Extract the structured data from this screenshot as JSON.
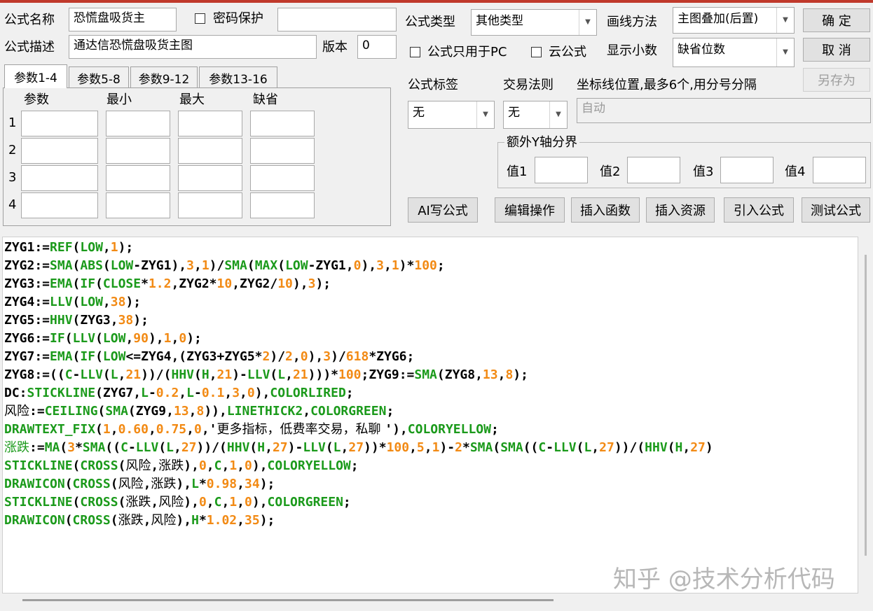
{
  "header": {
    "name_label": "公式名称",
    "name_value": "恐慌盘吸货主",
    "password_label": "密码保护",
    "password_value": "",
    "desc_label": "公式描述",
    "desc_value": "通达信恐慌盘吸货主图",
    "version_label": "版本",
    "version_value": "0"
  },
  "right": {
    "type_label": "公式类型",
    "type_value": "其他类型",
    "draw_label": "画线方法",
    "draw_value": "主图叠加(后置)",
    "pc_only_label": "公式只用于PC",
    "cloud_label": "云公式",
    "decimal_label": "显示小数",
    "decimal_value": "缺省位数",
    "tag_label": "公式标签",
    "tag_value": "无",
    "rule_label": "交易法则",
    "rule_value": "无",
    "axis_label": "坐标线位置,最多6个,用分号分隔",
    "axis_value": "自动",
    "yaxis_group_label": "额外Y轴分界",
    "yaxis": [
      "值1",
      "值2",
      "值3",
      "值4"
    ]
  },
  "buttons": {
    "ok": "确  定",
    "cancel": "取  消",
    "save_as": "另存为",
    "ai": "AI写公式",
    "edit": "编辑操作",
    "insert_func": "插入函数",
    "insert_res": "插入资源",
    "import": "引入公式",
    "test": "测试公式"
  },
  "params": {
    "tabs": [
      "参数1-4",
      "参数5-8",
      "参数9-12",
      "参数13-16"
    ],
    "columns": [
      "参数",
      "最小",
      "最大",
      "缺省"
    ],
    "rows": [
      "1",
      "2",
      "3",
      "4"
    ]
  },
  "code": {
    "lines": [
      [
        [
          "t",
          "ZYG1:="
        ],
        [
          "k",
          "REF"
        ],
        [
          "t",
          "("
        ],
        [
          "k",
          "LOW"
        ],
        [
          "t",
          ","
        ],
        [
          "n",
          "1"
        ],
        [
          "t",
          ");"
        ]
      ],
      [
        [
          "t",
          "ZYG2:="
        ],
        [
          "k",
          "SMA"
        ],
        [
          "t",
          "("
        ],
        [
          "k",
          "ABS"
        ],
        [
          "t",
          "("
        ],
        [
          "k",
          "LOW"
        ],
        [
          "t",
          "-ZYG1),"
        ],
        [
          "n",
          "3"
        ],
        [
          "t",
          ","
        ],
        [
          "n",
          "1"
        ],
        [
          "t",
          ")/"
        ],
        [
          "k",
          "SMA"
        ],
        [
          "t",
          "("
        ],
        [
          "k",
          "MAX"
        ],
        [
          "t",
          "("
        ],
        [
          "k",
          "LOW"
        ],
        [
          "t",
          "-ZYG1,"
        ],
        [
          "n",
          "0"
        ],
        [
          "t",
          "),"
        ],
        [
          "n",
          "3"
        ],
        [
          "t",
          ","
        ],
        [
          "n",
          "1"
        ],
        [
          "t",
          ")*"
        ],
        [
          "n",
          "100"
        ],
        [
          "t",
          ";"
        ]
      ],
      [
        [
          "t",
          "ZYG3:="
        ],
        [
          "k",
          "EMA"
        ],
        [
          "t",
          "("
        ],
        [
          "k",
          "IF"
        ],
        [
          "t",
          "("
        ],
        [
          "k",
          "CLOSE"
        ],
        [
          "t",
          "*"
        ],
        [
          "n",
          "1.2"
        ],
        [
          "t",
          ",ZYG2*"
        ],
        [
          "n",
          "10"
        ],
        [
          "t",
          ",ZYG2/"
        ],
        [
          "n",
          "10"
        ],
        [
          "t",
          "),"
        ],
        [
          "n",
          "3"
        ],
        [
          "t",
          ");"
        ]
      ],
      [
        [
          "t",
          "ZYG4:="
        ],
        [
          "k",
          "LLV"
        ],
        [
          "t",
          "("
        ],
        [
          "k",
          "LOW"
        ],
        [
          "t",
          ","
        ],
        [
          "n",
          "38"
        ],
        [
          "t",
          ");"
        ]
      ],
      [
        [
          "t",
          "ZYG5:="
        ],
        [
          "k",
          "HHV"
        ],
        [
          "t",
          "(ZYG3,"
        ],
        [
          "n",
          "38"
        ],
        [
          "t",
          ");"
        ]
      ],
      [
        [
          "t",
          "ZYG6:="
        ],
        [
          "k",
          "IF"
        ],
        [
          "t",
          "("
        ],
        [
          "k",
          "LLV"
        ],
        [
          "t",
          "("
        ],
        [
          "k",
          "LOW"
        ],
        [
          "t",
          ","
        ],
        [
          "n",
          "90"
        ],
        [
          "t",
          "),"
        ],
        [
          "n",
          "1"
        ],
        [
          "t",
          ","
        ],
        [
          "n",
          "0"
        ],
        [
          "t",
          ");"
        ]
      ],
      [
        [
          "t",
          "ZYG7:="
        ],
        [
          "k",
          "EMA"
        ],
        [
          "t",
          "("
        ],
        [
          "k",
          "IF"
        ],
        [
          "t",
          "("
        ],
        [
          "k",
          "LOW"
        ],
        [
          "t",
          "<=ZYG4,(ZYG3+ZYG5*"
        ],
        [
          "n",
          "2"
        ],
        [
          "t",
          ")/"
        ],
        [
          "n",
          "2"
        ],
        [
          "t",
          ","
        ],
        [
          "n",
          "0"
        ],
        [
          "t",
          "),"
        ],
        [
          "n",
          "3"
        ],
        [
          "t",
          ")/"
        ],
        [
          "n",
          "618"
        ],
        [
          "t",
          "*ZYG6;"
        ]
      ],
      [
        [
          "t",
          "ZYG8:=(("
        ],
        [
          "k",
          "C"
        ],
        [
          "t",
          "-"
        ],
        [
          "k",
          "LLV"
        ],
        [
          "t",
          "("
        ],
        [
          "k",
          "L"
        ],
        [
          "t",
          ","
        ],
        [
          "n",
          "21"
        ],
        [
          "t",
          "))/("
        ],
        [
          "k",
          "HHV"
        ],
        [
          "t",
          "("
        ],
        [
          "k",
          "H"
        ],
        [
          "t",
          ","
        ],
        [
          "n",
          "21"
        ],
        [
          "t",
          ")-"
        ],
        [
          "k",
          "LLV"
        ],
        [
          "t",
          "("
        ],
        [
          "k",
          "L"
        ],
        [
          "t",
          ","
        ],
        [
          "n",
          "21"
        ],
        [
          "t",
          ")))*"
        ],
        [
          "n",
          "100"
        ],
        [
          "t",
          ";ZYG9:="
        ],
        [
          "k",
          "SMA"
        ],
        [
          "t",
          "(ZYG8,"
        ],
        [
          "n",
          "13"
        ],
        [
          "t",
          ","
        ],
        [
          "n",
          "8"
        ],
        [
          "t",
          ");"
        ]
      ],
      [
        [
          "t",
          "DC:"
        ],
        [
          "k",
          "STICKLINE"
        ],
        [
          "t",
          "(ZYG7,"
        ],
        [
          "k",
          "L"
        ],
        [
          "t",
          "-"
        ],
        [
          "n",
          "0.2"
        ],
        [
          "t",
          ","
        ],
        [
          "k",
          "L"
        ],
        [
          "t",
          "-"
        ],
        [
          "n",
          "0.1"
        ],
        [
          "t",
          ","
        ],
        [
          "n",
          "3"
        ],
        [
          "t",
          ","
        ],
        [
          "n",
          "0"
        ],
        [
          "t",
          "),"
        ],
        [
          "k",
          "COLORLIRED"
        ],
        [
          "t",
          ";"
        ]
      ],
      [
        [
          "c",
          "风险"
        ],
        [
          "t",
          ":="
        ],
        [
          "k",
          "CEILING"
        ],
        [
          "t",
          "("
        ],
        [
          "k",
          "SMA"
        ],
        [
          "t",
          "(ZYG9,"
        ],
        [
          "n",
          "13"
        ],
        [
          "t",
          ","
        ],
        [
          "n",
          "8"
        ],
        [
          "t",
          "))"
        ],
        [
          "t",
          ","
        ],
        [
          "k",
          "LINETHICK2"
        ],
        [
          "t",
          ","
        ],
        [
          "k",
          "COLORGREEN"
        ],
        [
          "t",
          ";"
        ]
      ],
      [
        [
          "k",
          "DRAWTEXT_FIX"
        ],
        [
          "t",
          "("
        ],
        [
          "n",
          "1"
        ],
        [
          "t",
          ","
        ],
        [
          "n",
          "0.60"
        ],
        [
          "t",
          ","
        ],
        [
          "n",
          "0.75"
        ],
        [
          "t",
          ","
        ],
        [
          "n",
          "0"
        ],
        [
          "t",
          ",'"
        ],
        [
          "c",
          "更多指标，低费率交易，私聊 "
        ],
        [
          "t",
          "'),"
        ],
        [
          "k",
          "COLORYELLOW"
        ],
        [
          "t",
          ";"
        ]
      ],
      [
        [
          "v",
          "涨跌"
        ],
        [
          "t",
          ":="
        ],
        [
          "k",
          "MA"
        ],
        [
          "t",
          "("
        ],
        [
          "n",
          "3"
        ],
        [
          "t",
          "*"
        ],
        [
          "k",
          "SMA"
        ],
        [
          "t",
          "(("
        ],
        [
          "k",
          "C"
        ],
        [
          "t",
          "-"
        ],
        [
          "k",
          "LLV"
        ],
        [
          "t",
          "("
        ],
        [
          "k",
          "L"
        ],
        [
          "t",
          ","
        ],
        [
          "n",
          "27"
        ],
        [
          "t",
          "))/("
        ],
        [
          "k",
          "HHV"
        ],
        [
          "t",
          "("
        ],
        [
          "k",
          "H"
        ],
        [
          "t",
          ","
        ],
        [
          "n",
          "27"
        ],
        [
          "t",
          ")-"
        ],
        [
          "k",
          "LLV"
        ],
        [
          "t",
          "("
        ],
        [
          "k",
          "L"
        ],
        [
          "t",
          ","
        ],
        [
          "n",
          "27"
        ],
        [
          "t",
          "))*"
        ],
        [
          "n",
          "100"
        ],
        [
          "t",
          ","
        ],
        [
          "n",
          "5"
        ],
        [
          "t",
          ","
        ],
        [
          "n",
          "1"
        ],
        [
          "t",
          ")-"
        ],
        [
          "n",
          "2"
        ],
        [
          "t",
          "*"
        ],
        [
          "k",
          "SMA"
        ],
        [
          "t",
          "("
        ],
        [
          "k",
          "SMA"
        ],
        [
          "t",
          "(("
        ],
        [
          "k",
          "C"
        ],
        [
          "t",
          "-"
        ],
        [
          "k",
          "LLV"
        ],
        [
          "t",
          "("
        ],
        [
          "k",
          "L"
        ],
        [
          "t",
          ","
        ],
        [
          "n",
          "27"
        ],
        [
          "t",
          "))/("
        ],
        [
          "k",
          "HHV"
        ],
        [
          "t",
          "("
        ],
        [
          "k",
          "H"
        ],
        [
          "t",
          ","
        ],
        [
          "n",
          "27"
        ],
        [
          "t",
          ")"
        ]
      ],
      [
        [
          "k",
          "STICKLINE"
        ],
        [
          "t",
          "("
        ],
        [
          "k",
          "CROSS"
        ],
        [
          "t",
          "("
        ],
        [
          "c",
          "风险"
        ],
        [
          "t",
          ","
        ],
        [
          "c",
          "涨跌"
        ],
        [
          "t",
          "),"
        ],
        [
          "n",
          "0"
        ],
        [
          "t",
          ","
        ],
        [
          "k",
          "C"
        ],
        [
          "t",
          ","
        ],
        [
          "n",
          "1"
        ],
        [
          "t",
          ","
        ],
        [
          "n",
          "0"
        ],
        [
          "t",
          "),"
        ],
        [
          "k",
          "COLORYELLOW"
        ],
        [
          "t",
          ";"
        ]
      ],
      [
        [
          "k",
          "DRAWICON"
        ],
        [
          "t",
          "("
        ],
        [
          "k",
          "CROSS"
        ],
        [
          "t",
          "("
        ],
        [
          "c",
          "风险"
        ],
        [
          "t",
          ","
        ],
        [
          "c",
          "涨跌"
        ],
        [
          "t",
          "),"
        ],
        [
          "k",
          "L"
        ],
        [
          "t",
          "*"
        ],
        [
          "n",
          "0.98"
        ],
        [
          "t",
          ","
        ],
        [
          "n",
          "34"
        ],
        [
          "t",
          ");"
        ]
      ],
      [
        [
          "k",
          "STICKLINE"
        ],
        [
          "t",
          "("
        ],
        [
          "k",
          "CROSS"
        ],
        [
          "t",
          "("
        ],
        [
          "c",
          "涨跌"
        ],
        [
          "t",
          ","
        ],
        [
          "c",
          "风险"
        ],
        [
          "t",
          "),"
        ],
        [
          "n",
          "0"
        ],
        [
          "t",
          ","
        ],
        [
          "k",
          "C"
        ],
        [
          "t",
          ","
        ],
        [
          "n",
          "1"
        ],
        [
          "t",
          ","
        ],
        [
          "n",
          "0"
        ],
        [
          "t",
          "),"
        ],
        [
          "k",
          "COLORGREEN"
        ],
        [
          "t",
          ";"
        ]
      ],
      [
        [
          "k",
          "DRAWICON"
        ],
        [
          "t",
          "("
        ],
        [
          "k",
          "CROSS"
        ],
        [
          "t",
          "("
        ],
        [
          "c",
          "涨跌"
        ],
        [
          "t",
          ","
        ],
        [
          "c",
          "风险"
        ],
        [
          "t",
          "),"
        ],
        [
          "k",
          "H"
        ],
        [
          "t",
          "*"
        ],
        [
          "n",
          "1.02"
        ],
        [
          "t",
          ","
        ],
        [
          "n",
          "35"
        ],
        [
          "t",
          ");"
        ]
      ]
    ]
  },
  "watermark": "知乎 @技术分析代码",
  "colors": {
    "keyword": "#1b9a1b",
    "number": "#f28a14",
    "title_bar": "#c0392b"
  }
}
